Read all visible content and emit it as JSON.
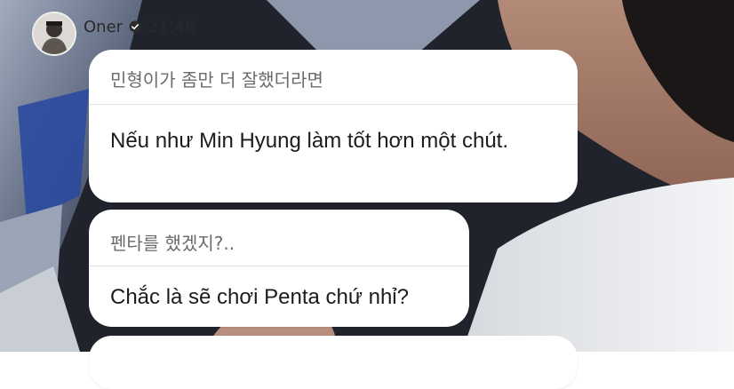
{
  "header": {
    "username": "Oner",
    "timestamp": "21:46",
    "avatar_icon": "avatar-photo",
    "verified_icon": "verified-check-icon"
  },
  "messages": [
    {
      "original": "민형이가 좀만 더 잘했더라면",
      "translation": "Nếu như Min Hyung làm tốt hơn một chút."
    },
    {
      "original": "펜타를 했겠지?..",
      "translation": "Chắc là sẽ chơi Penta chứ nhỉ?"
    },
    {
      "original": "",
      "translation": ""
    }
  ],
  "colors": {
    "bubble": "#ffffff",
    "original_text": "#6b6b6b",
    "translation_text": "#1c1c1c",
    "divider": "#e2e2e2"
  }
}
